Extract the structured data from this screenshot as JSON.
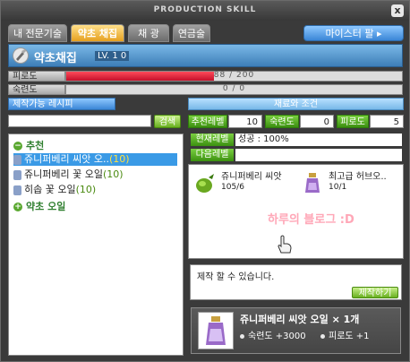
{
  "window": {
    "title": "PRODUCTION SKILL",
    "close_label": "x"
  },
  "tabs": [
    {
      "label": "내 전문기술",
      "active": false
    },
    {
      "label": "약초 채집",
      "active": true
    },
    {
      "label": "채 광",
      "active": false
    },
    {
      "label": "연금술",
      "active": false
    }
  ],
  "master_button": "마이스터 팔 ▸",
  "skill": {
    "icon": "herb-gathering-icon",
    "name": "약초채집",
    "level": "LV. 1 0"
  },
  "stats": [
    {
      "label": "피로도",
      "value_text": "88 / 200",
      "fill": 0.44
    },
    {
      "label": "숙련도",
      "value_text": "0 / 0",
      "fill": 0
    }
  ],
  "recipes": {
    "header": "제작가능 레시피",
    "search_placeholder": "",
    "search_button": "검색",
    "categories": [
      {
        "label": "추천",
        "items": [
          {
            "name": "쥬니퍼베리 씨앗 오..",
            "level": "(10)",
            "selected": true
          },
          {
            "name": "쥬니퍼베리 꽃 오일",
            "level": "(10)",
            "selected": false
          },
          {
            "name": "히솝 꽃 오일",
            "level": "(10)",
            "selected": false
          }
        ]
      },
      {
        "label": "약초 오일",
        "items": []
      }
    ]
  },
  "materials": {
    "header": "재료와 조건",
    "requirements": [
      {
        "label": "추천레벨",
        "value": "10"
      },
      {
        "label": "숙련도",
        "value": "0"
      },
      {
        "label": "피로도",
        "value": "5"
      }
    ],
    "current_level_label": "현재레벨",
    "current_level_value": "성공 : 100%",
    "next_level_label": "다음레벨",
    "next_level_value": "",
    "items": [
      {
        "name": "쥬니퍼베리 씨앗",
        "count": "105/6",
        "icon": "green-seed-icon"
      },
      {
        "name": "최고급 허브오..",
        "count": "10/1",
        "icon": "herb-oil-bottle-icon"
      }
    ],
    "watermark": "하루의 블로그 :D",
    "message": "제작 할 수 있습니다.",
    "craft_button": "제작하기"
  },
  "result": {
    "name": "쥬니퍼베리 씨앗 오일 × 1개",
    "stat1": "숙련도 +3000",
    "stat2": "피로도 +1",
    "icon": "oil-bottle-icon"
  },
  "colors": {
    "accent_blue": "#3a86d6",
    "fatigue_red": "#c4102a",
    "green_button": "#68b020",
    "active_tab": "#e6a020"
  }
}
